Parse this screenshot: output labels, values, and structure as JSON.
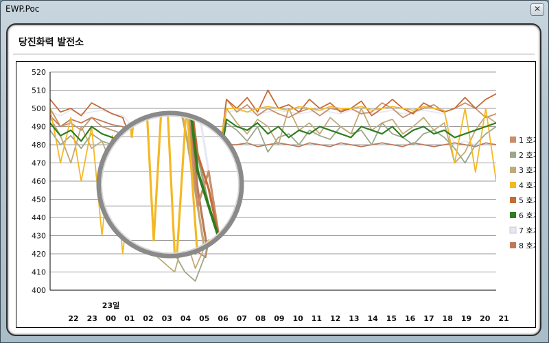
{
  "window": {
    "title": "EWP.Poc",
    "close_label": "✕"
  },
  "panel": {
    "title": "당진화력 발전소"
  },
  "chart_data": {
    "type": "line",
    "ylim": [
      400,
      520
    ],
    "yticks": [
      400,
      410,
      420,
      430,
      440,
      450,
      460,
      470,
      480,
      490,
      500,
      510,
      520
    ],
    "x_labels": [
      "22",
      "23",
      "00",
      "01",
      "02",
      "03",
      "04",
      "05",
      "06",
      "07",
      "08",
      "09",
      "10",
      "11",
      "12",
      "13",
      "14",
      "15",
      "16",
      "17",
      "18",
      "19",
      "20",
      "21"
    ],
    "date_label": "23일",
    "grid": true,
    "legend_position": "right",
    "series": [
      {
        "name": "1 호기",
        "color": "#c8906a",
        "values": [
          500,
          490,
          492,
          488,
          495,
          490,
          488,
          486,
          470,
          440,
          450,
          430,
          425,
          430,
          420,
          425,
          450,
          505,
          498,
          502,
          496,
          500,
          497,
          495,
          498,
          500,
          496,
          500,
          499,
          500,
          497,
          498,
          503,
          500,
          495,
          498,
          500,
          502,
          498,
          500,
          503,
          500,
          495,
          497
        ]
      },
      {
        "name": "2 호기",
        "color": "#9aa88a",
        "values": [
          488,
          480,
          485,
          478,
          486,
          482,
          480,
          476,
          470,
          455,
          440,
          430,
          420,
          410,
          405,
          420,
          460,
          492,
          488,
          482,
          490,
          476,
          484,
          486,
          480,
          488,
          485,
          483,
          490,
          486,
          488,
          480,
          492,
          486,
          484,
          480,
          486,
          488,
          484,
          478,
          470,
          480,
          486,
          490
        ]
      },
      {
        "name": "3 호기",
        "color": "#c0aa78",
        "values": [
          495,
          485,
          470,
          490,
          478,
          482,
          468,
          475,
          460,
          440,
          420,
          415,
          410,
          430,
          412,
          425,
          455,
          500,
          492,
          486,
          494,
          490,
          480,
          500,
          488,
          492,
          486,
          495,
          490,
          486,
          500,
          488,
          492,
          494,
          486,
          490,
          495,
          488,
          492,
          470,
          476,
          488,
          496,
          492
        ]
      },
      {
        "name": "4 호기",
        "color": "#f4b823",
        "values": [
          500,
          470,
          495,
          460,
          490,
          430,
          485,
          420,
          470,
          425,
          430,
          418,
          425,
          430,
          420,
          440,
          470,
          500,
          500,
          498,
          500,
          501,
          500,
          499,
          501,
          500,
          499,
          501,
          500,
          500,
          501,
          499,
          500,
          501,
          500,
          499,
          501,
          500,
          499,
          470,
          500,
          465,
          500,
          460
        ]
      },
      {
        "name": "5 호기",
        "color": "#c66a38",
        "values": [
          505,
          498,
          500,
          496,
          503,
          500,
          497,
          495,
          480,
          455,
          445,
          430,
          422,
          420,
          425,
          430,
          460,
          505,
          500,
          506,
          498,
          510,
          500,
          502,
          498,
          505,
          500,
          503,
          498,
          500,
          504,
          496,
          500,
          505,
          500,
          497,
          503,
          500,
          498,
          500,
          506,
          500,
          505,
          508
        ]
      },
      {
        "name": "6 호기",
        "color": "#2e7d1e",
        "values": [
          492,
          485,
          488,
          482,
          490,
          486,
          484,
          482,
          478,
          450,
          440,
          430,
          425,
          422,
          420,
          430,
          455,
          494,
          490,
          488,
          492,
          486,
          490,
          484,
          488,
          486,
          490,
          488,
          486,
          484,
          490,
          488,
          486,
          490,
          484,
          488,
          490,
          486,
          488,
          484,
          486,
          488,
          490,
          492
        ]
      },
      {
        "name": "7 호기",
        "color": "#e6e8f4",
        "values": [
          498,
          496,
          499,
          497,
          498,
          499,
          497,
          496,
          490,
          470,
          450,
          430,
          425,
          420,
          425,
          440,
          470,
          498,
          499,
          498,
          497,
          498,
          499,
          498,
          497,
          498,
          499,
          498,
          497,
          499,
          498,
          497,
          498,
          499,
          497,
          498,
          499,
          498,
          497,
          480,
          482,
          480,
          481,
          480
        ]
      },
      {
        "name": "8 호기",
        "color": "#c0785a",
        "values": [
          496,
          490,
          494,
          492,
          495,
          493,
          491,
          490,
          475,
          445,
          425,
          420,
          418,
          420,
          422,
          418,
          450,
          480,
          480,
          481,
          479,
          480,
          481,
          480,
          479,
          481,
          480,
          479,
          481,
          480,
          479,
          480,
          481,
          480,
          479,
          481,
          480,
          479,
          480,
          481,
          480,
          479,
          481,
          480
        ]
      }
    ]
  }
}
